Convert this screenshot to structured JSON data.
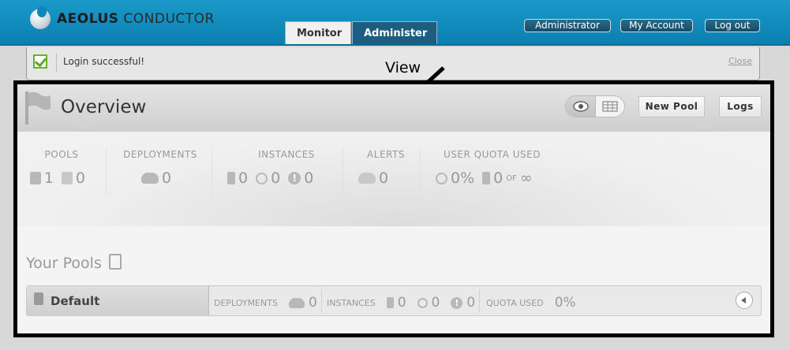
{
  "header": {
    "logo_bold": "AEOLUS",
    "logo_rest": "CONDUCTOR",
    "tabs": [
      {
        "label": "Monitor",
        "active": true
      },
      {
        "label": "Administer",
        "active": false
      }
    ],
    "user_buttons": {
      "admin": "Administrator",
      "account": "My Account",
      "logout": "Log out"
    }
  },
  "flash": {
    "message": "Login successful!",
    "close_label": "Close"
  },
  "annotation": {
    "label": "View"
  },
  "overview": {
    "title": "Overview",
    "new_pool_label": "New Pool",
    "logs_label": "Logs"
  },
  "stats": {
    "pools": {
      "label": "POOLS",
      "a": "1",
      "b": "0"
    },
    "deployments": {
      "label": "DEPLOYMENTS",
      "value": "0"
    },
    "instances": {
      "label": "INSTANCES",
      "a": "0",
      "b": "0",
      "c": "0"
    },
    "alerts": {
      "label": "ALERTS",
      "value": "0"
    },
    "quota": {
      "label": "USER QUOTA USED",
      "percent": "0%",
      "count": "0",
      "of": "OF",
      "limit": "∞"
    }
  },
  "pools_section": {
    "title": "Your Pools",
    "rows": [
      {
        "name": "Default",
        "deployments_label": "DEPLOYMENTS",
        "deployments": "0",
        "instances_label": "INSTANCES",
        "instances_a": "0",
        "instances_b": "0",
        "instances_c": "0",
        "quota_label": "QUOTA USED",
        "quota": "0%"
      }
    ]
  },
  "colors": {
    "header_blue": "#0e86b8",
    "active_tab_bg": "#1c5d80",
    "success_green": "#62a82a"
  }
}
